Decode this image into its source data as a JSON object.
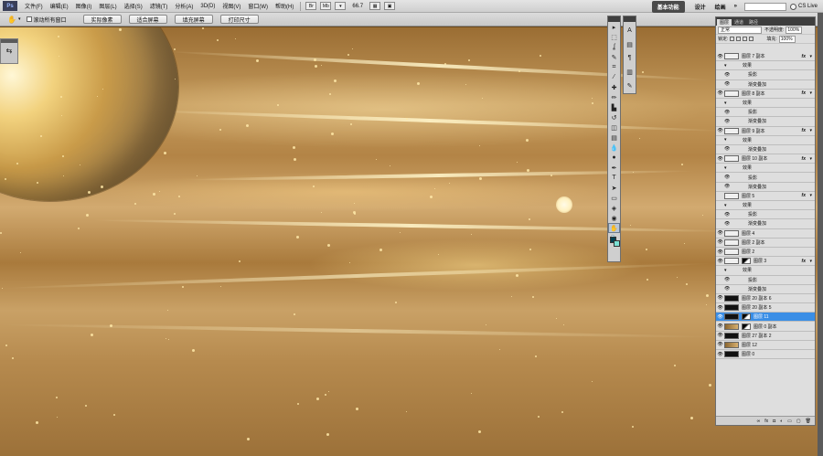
{
  "menubar": {
    "logo": "Ps",
    "items": [
      "文件(F)",
      "编辑(E)",
      "图像(I)",
      "图层(L)",
      "选择(S)",
      "滤镜(T)",
      "分析(A)",
      "3D(D)",
      "视图(V)",
      "窗口(W)",
      "帮助(H)"
    ],
    "bridge": "Br",
    "minibridge": "Mb",
    "zoom": "66.7",
    "workspaces": {
      "active": "基本功能",
      "design": "设计",
      "painting": "绘画",
      "more": "»"
    },
    "cs_live": "CS Live"
  },
  "options": {
    "scroll_all_label": "滚动所有窗口",
    "buttons": [
      "实际像素",
      "适合屏幕",
      "填充屏幕",
      "打印尺寸"
    ]
  },
  "layers_panel": {
    "tabs": [
      "图层",
      "通道",
      "路径"
    ],
    "blend_mode": "正常",
    "opacity_label": "不透明度:",
    "opacity_value": "100%",
    "lock_label": "锁定:",
    "fill_label": "填充:",
    "fill_value": "100%",
    "layers": [
      {
        "name": "图层 7 副本",
        "kind": "layer",
        "fx": true,
        "visible": true
      },
      {
        "name": "效果",
        "kind": "effects"
      },
      {
        "name": "投影",
        "kind": "effect"
      },
      {
        "name": "渐变叠加",
        "kind": "effect"
      },
      {
        "name": "图层 8 副本",
        "kind": "layer",
        "fx": true,
        "visible": true
      },
      {
        "name": "效果",
        "kind": "effects"
      },
      {
        "name": "投影",
        "kind": "effect"
      },
      {
        "name": "渐变叠加",
        "kind": "effect"
      },
      {
        "name": "图层 9 副本",
        "kind": "layer",
        "fx": true,
        "visible": true
      },
      {
        "name": "效果",
        "kind": "effects"
      },
      {
        "name": "渐变叠加",
        "kind": "effect"
      },
      {
        "name": "图层 10 副本",
        "kind": "layer",
        "fx": true,
        "visible": true
      },
      {
        "name": "效果",
        "kind": "effects"
      },
      {
        "name": "投影",
        "kind": "effect"
      },
      {
        "name": "渐变叠加",
        "kind": "effect"
      },
      {
        "name": "图层 5",
        "kind": "layer",
        "fx": true,
        "visible": false
      },
      {
        "name": "效果",
        "kind": "effects"
      },
      {
        "name": "投影",
        "kind": "effect"
      },
      {
        "name": "渐变叠加",
        "kind": "effect"
      },
      {
        "name": "图层 4",
        "kind": "layer",
        "visible": true
      },
      {
        "name": "图层 2 副本",
        "kind": "layer",
        "visible": true
      },
      {
        "name": "图层 2",
        "kind": "layer",
        "visible": true
      },
      {
        "name": "图层 3",
        "kind": "masked",
        "fx": true,
        "visible": true
      },
      {
        "name": "效果",
        "kind": "effects"
      },
      {
        "name": "投影",
        "kind": "effect"
      },
      {
        "name": "渐变叠加",
        "kind": "effect"
      },
      {
        "name": "图层 20 副本 6",
        "kind": "dark",
        "visible": true
      },
      {
        "name": "图层 20 副本 5",
        "kind": "dark",
        "visible": true
      },
      {
        "name": "图层 11",
        "kind": "selected",
        "visible": true
      },
      {
        "name": "图层 0 副本",
        "kind": "img-masked",
        "visible": true
      },
      {
        "name": "图层 27 副本 2",
        "kind": "dark",
        "visible": true
      },
      {
        "name": "图层 12",
        "kind": "img",
        "visible": true
      },
      {
        "name": "图层 0",
        "kind": "dark",
        "visible": true
      }
    ],
    "footer_icons": [
      "link-icon",
      "fx-icon",
      "mask-icon",
      "adjustment-icon",
      "folder-icon",
      "new-layer-icon",
      "trash-icon"
    ]
  },
  "tools": [
    "move",
    "marquee",
    "lasso",
    "quick-select",
    "crop",
    "eyedropper",
    "healing",
    "brush",
    "stamp",
    "history-brush",
    "eraser",
    "gradient",
    "blur",
    "dodge",
    "pen",
    "type",
    "path-select",
    "shape",
    "3d-rotate",
    "3d-orbit",
    "hand",
    "zoom"
  ],
  "tool_glyphs": [
    "▸",
    "⬚",
    "ʆ",
    "✎",
    "⌗",
    "⁄",
    "✚",
    "✏",
    "▙",
    "↺",
    "◫",
    "▤",
    "💧",
    "●",
    "✒",
    "T",
    "➤",
    "▭",
    "◈",
    "◉",
    "✋",
    "🔍"
  ],
  "active_tool": "hand",
  "colors": {
    "foreground": "#003f4f",
    "background": "#7ae0d4",
    "selected_layer": "#3a8ee6"
  }
}
